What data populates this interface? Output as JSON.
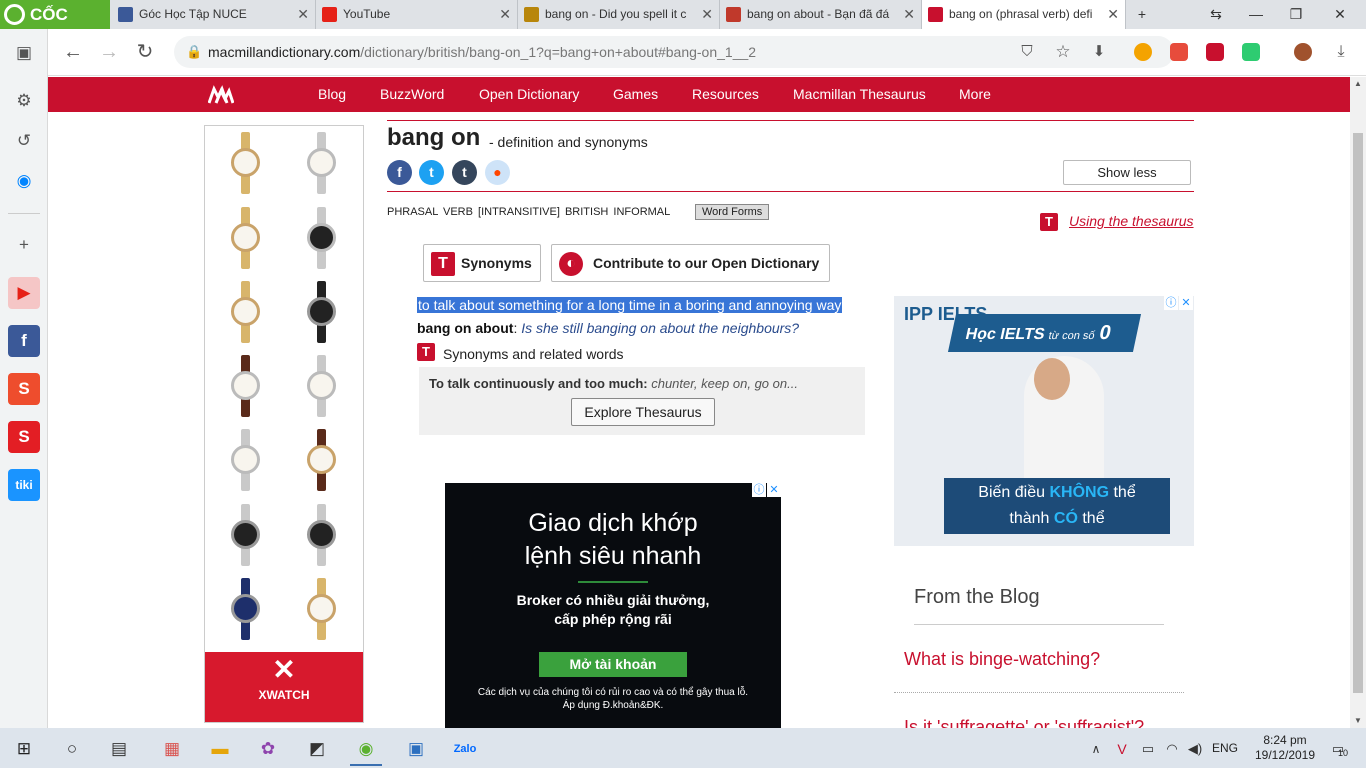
{
  "browser": {
    "brand": "CỐC CỐC",
    "tabs": [
      {
        "title": "Góc Học Tập NUCE",
        "color": "#3b5998"
      },
      {
        "title": "YouTube",
        "color": "#e62117"
      },
      {
        "title": "bang on - Did you spell it c",
        "color": "#b8860b"
      },
      {
        "title": "bang on about - Bạn đã đá",
        "color": "#c0392b"
      },
      {
        "title": "bang on (phrasal verb) defi",
        "color": "#c8102e"
      }
    ],
    "url_host": "macmillandictionary.com",
    "url_path": "/dictionary/british/bang-on_1?q=bang+on+about#bang-on_1__2"
  },
  "nav": {
    "items": [
      "Blog",
      "BuzzWord",
      "Open Dictionary",
      "Games",
      "Resources",
      "Macmillan Thesaurus",
      "More"
    ]
  },
  "entry": {
    "headword": "bang on",
    "subtitle": "- definition and synonyms",
    "show_less": "Show less",
    "grammar": "PHRASAL VERB  [INTRANSITIVE]  BRITISH  INFORMAL",
    "word_forms": "Word Forms",
    "using_thesaurus": "Using the thesaurus",
    "synonyms_btn": "Synonyms",
    "contribute_btn": "Contribute to our Open Dictionary",
    "definition": "to talk about something for a long time in a boring and annoying way",
    "example_phrase": "bang on about",
    "example_text": "Is she still banging on about the neighbours?",
    "synonyms_related": "Synonyms and related words",
    "thes_bold": "To talk continuously and too much:",
    "thes_words": "chunter, keep on, go on...",
    "explore": "Explore Thesaurus"
  },
  "ads": {
    "xwatch": "XWATCH",
    "mid_line1": "Giao dịch khớp",
    "mid_line2": "lệnh siêu nhanh",
    "mid_sub1": "Broker có nhiều giải thưởng,",
    "mid_sub2": "cấp phép rộng rãi",
    "mid_cta": "Mở tài khoản",
    "mid_disc1": "Các dịch vụ của chúng tôi có rủi ro cao và có thể gây thua lỗ.",
    "mid_disc2": "Áp dụng Đ.khoản&ĐK.",
    "right_logo": "IPP IELTS",
    "right_banner_a": "Học IELTS",
    "right_banner_b": "từ con số",
    "right_banner_c": "0",
    "right_b2_a": "Biến điều",
    "right_b2_b": "KHÔNG",
    "right_b2_c": "thể",
    "right_b2_d": "thành",
    "right_b2_e": "CÓ",
    "right_b2_f": "thể"
  },
  "blog": {
    "title": "From the Blog",
    "links": [
      "What is binge-watching?",
      "Is it 'suffragette' or 'suffragist'?"
    ]
  },
  "taskbar": {
    "lang": "ENG",
    "time": "8:24 pm",
    "date": "19/12/2019",
    "notif": "10"
  }
}
